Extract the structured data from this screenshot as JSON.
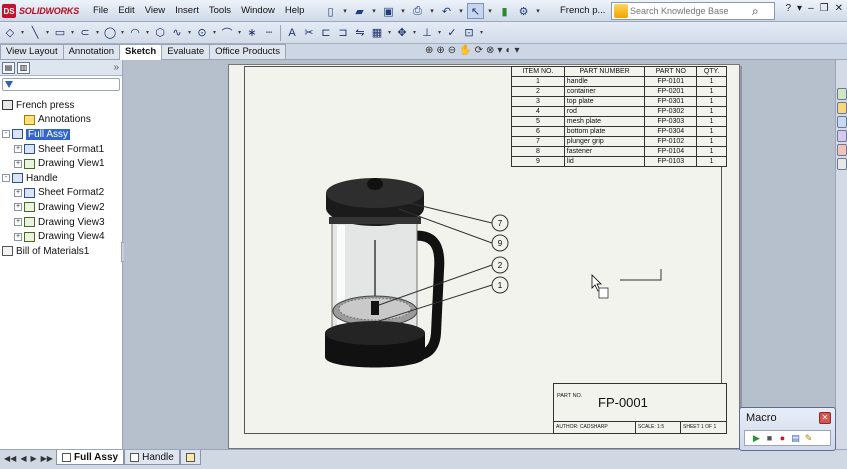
{
  "app": {
    "logo_text": "SOLIDWORKS",
    "logo_mark": "DS"
  },
  "menu": [
    "File",
    "Edit",
    "View",
    "Insert",
    "Tools",
    "Window",
    "Help"
  ],
  "document_title": "French p...",
  "search": {
    "placeholder": "Search Knowledge Base"
  },
  "command_tabs": [
    "View Layout",
    "Annotation",
    "Sketch",
    "Evaluate",
    "Office Products"
  ],
  "active_command_tab": "Sketch",
  "feature_tree": [
    {
      "label": "French press",
      "depth": 0,
      "icon": "drawing-icon",
      "expander": ""
    },
    {
      "label": "Annotations",
      "depth": 1,
      "icon": "annotations-icon",
      "expander": ""
    },
    {
      "label": "Full Assy",
      "depth": 0,
      "icon": "sheet-icon",
      "expander": "-",
      "selected": true
    },
    {
      "label": "Sheet Format1",
      "depth": 1,
      "icon": "sheet-format-icon",
      "expander": "+"
    },
    {
      "label": "Drawing View1",
      "depth": 1,
      "icon": "drawing-view-icon",
      "expander": "+"
    },
    {
      "label": "Handle",
      "depth": 0,
      "icon": "sheet-icon",
      "expander": "-"
    },
    {
      "label": "Sheet Format2",
      "depth": 1,
      "icon": "sheet-format-icon",
      "expander": "+"
    },
    {
      "label": "Drawing View2",
      "depth": 1,
      "icon": "drawing-view-icon",
      "expander": "+"
    },
    {
      "label": "Drawing View3",
      "depth": 1,
      "icon": "drawing-view-icon",
      "expander": "+"
    },
    {
      "label": "Drawing View4",
      "depth": 1,
      "icon": "drawing-view-icon",
      "expander": "+"
    },
    {
      "label": "Bill of Materials1",
      "depth": 0,
      "icon": "bom-icon",
      "expander": ""
    }
  ],
  "bom": {
    "headers": [
      "ITEM NO.",
      "PART NUMBER",
      "PART NO",
      "QTY."
    ],
    "rows": [
      [
        "1",
        "handle",
        "FP-0101",
        "1"
      ],
      [
        "2",
        "container",
        "FP-0201",
        "1"
      ],
      [
        "3",
        "top plate",
        "FP-0301",
        "1"
      ],
      [
        "4",
        "rod",
        "FP-0302",
        "1"
      ],
      [
        "5",
        "mesh plate",
        "FP-0303",
        "1"
      ],
      [
        "6",
        "bottom plate",
        "FP-0304",
        "1"
      ],
      [
        "7",
        "plunger grip",
        "FP-0102",
        "1"
      ],
      [
        "8",
        "fastener",
        "FP-0104",
        "1"
      ],
      [
        "9",
        "lid",
        "FP-0103",
        "1"
      ]
    ]
  },
  "balloons": [
    "7",
    "9",
    "2",
    "1"
  ],
  "title_block": {
    "part_no_label": "PART NO.",
    "part_no": "FP-0001",
    "author": "AUTHOR: CADSHARP",
    "scale": "SCALE: 1:5",
    "sheet": "SHEET 1 OF 1"
  },
  "sheet_tabs": [
    {
      "label": "Full Assy",
      "active": true
    },
    {
      "label": "Handle",
      "active": false
    }
  ],
  "macro": {
    "title": "Macro",
    "close": "✕"
  },
  "colors": {
    "selection": "#3366cc",
    "brand": "#c8102e"
  }
}
